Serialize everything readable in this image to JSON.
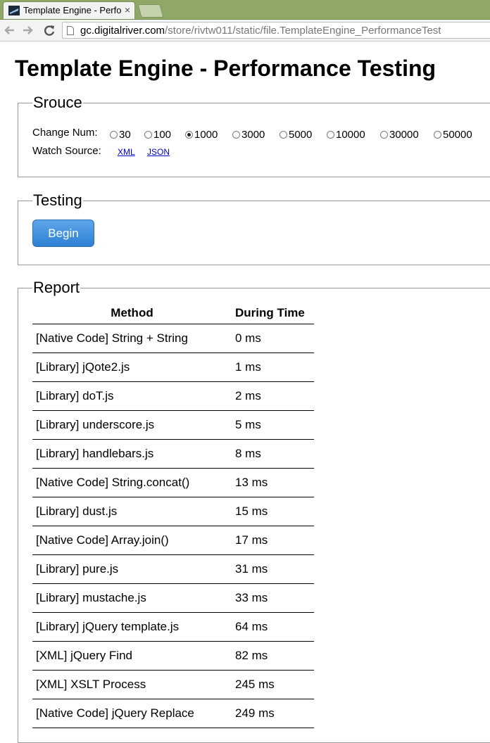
{
  "browser": {
    "tab_title": "Template Engine - Perfo",
    "tab_close": "×",
    "url_host": "gc.digitalriver.com",
    "url_path": "/store/rivtw011/static/file.TemplateEngine_PerformanceTest"
  },
  "page": {
    "title": "Template Engine - Performance Testing"
  },
  "source": {
    "legend": "Srouce",
    "change_num_label": "Change Num:",
    "options": [
      "30",
      "100",
      "1000",
      "3000",
      "5000",
      "10000",
      "30000",
      "50000"
    ],
    "selected": "1000",
    "watch_source_label": "Watch Source:",
    "links": [
      "XML",
      "JSON"
    ]
  },
  "testing": {
    "legend": "Testing",
    "begin_label": "Begin"
  },
  "report": {
    "legend": "Report",
    "headers": [
      "Method",
      "During Time"
    ],
    "rows": [
      {
        "method": "[Native Code] String + String",
        "time": "0 ms"
      },
      {
        "method": "[Library] jQote2.js",
        "time": "1 ms"
      },
      {
        "method": "[Library] doT.js",
        "time": "2 ms"
      },
      {
        "method": "[Library] underscore.js",
        "time": "5 ms"
      },
      {
        "method": "[Library] handlebars.js",
        "time": "8 ms"
      },
      {
        "method": "[Native Code] String.concat()",
        "time": "13 ms"
      },
      {
        "method": "[Library] dust.js",
        "time": "15 ms"
      },
      {
        "method": "[Native Code] Array.join()",
        "time": "17 ms"
      },
      {
        "method": "[Library] pure.js",
        "time": "31 ms"
      },
      {
        "method": "[Library] mustache.js",
        "time": "33 ms"
      },
      {
        "method": "[Library] jQuery template.js",
        "time": "64 ms"
      },
      {
        "method": "[XML] jQuery Find",
        "time": "82 ms"
      },
      {
        "method": "[XML] XSLT Process",
        "time": "245 ms"
      },
      {
        "method": "[Native Code] jQuery Replace",
        "time": "249 ms"
      }
    ]
  }
}
